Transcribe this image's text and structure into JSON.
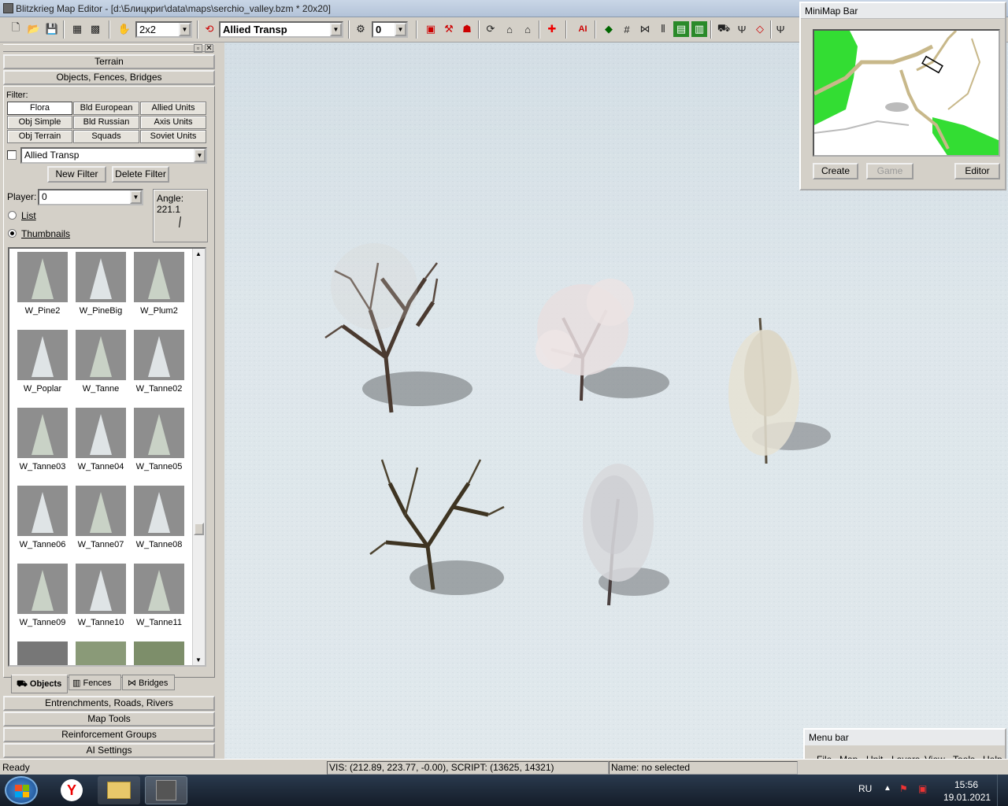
{
  "window": {
    "title": "Blitzkrieg Map Editor - [d:\\Блицкриг\\data\\maps\\serchio_valley.bzm *  20x20]"
  },
  "toolbar": {
    "brush_size": "2x2",
    "unit_filter": "Allied Transp",
    "player_value": "0",
    "ai_label": "AI"
  },
  "left_panel": {
    "sections_top": [
      "Terrain",
      "Objects, Fences, Bridges"
    ],
    "filter_label": "Filter:",
    "filter_buttons": [
      [
        "Flora",
        "Bld European",
        "Allied Units"
      ],
      [
        "Obj Simple",
        "Bld Russian",
        "Axis Units"
      ],
      [
        "Obj Terrain",
        "Squads",
        "Soviet Units"
      ]
    ],
    "filter_combo": "Allied Transp",
    "new_filter": "New Filter",
    "delete_filter": "Delete Filter",
    "player_label": "Player:",
    "player_value": "0",
    "angle_label": "Angle: 221.1",
    "view_list": "List",
    "view_thumbnails": "Thumbnails",
    "thumbnails": [
      "W_Pine2",
      "W_PineBig",
      "W_Plum2",
      "W_Poplar",
      "W_Tanne",
      "W_Tanne02",
      "W_Tanne03",
      "W_Tanne04",
      "W_Tanne05",
      "W_Tanne06",
      "W_Tanne07",
      "W_Tanne08",
      "W_Tanne09",
      "W_Tanne10",
      "W_Tanne11"
    ],
    "tabs": [
      "Objects",
      "Fences",
      "Bridges"
    ],
    "sections_bottom": [
      "Entrenchments, Roads, Rivers",
      "Map Tools",
      "Reinforcement Groups",
      "AI Settings"
    ]
  },
  "minimap": {
    "title": "MiniMap Bar",
    "buttons": [
      "Create",
      "Game",
      "Editor"
    ]
  },
  "menubar": {
    "title": "Menu bar",
    "items": [
      "File",
      "Map",
      "Unit",
      "Layers",
      "View",
      "Tools",
      "Help"
    ]
  },
  "status": {
    "ready": "Ready",
    "vis": "VIS: (212.89, 223.77, -0.00), SCRIPT: (13625, 14321)",
    "name": "Name: no selected"
  },
  "taskbar": {
    "lang": "RU",
    "time": "15:56",
    "date": "19.01.2021"
  },
  "colors": {
    "panel": "#d4d0c8",
    "snow": "#e3eaee",
    "taskbar": "#1c2636",
    "minimap_green": "#33dd33",
    "minimap_road": "#c8b88a"
  }
}
